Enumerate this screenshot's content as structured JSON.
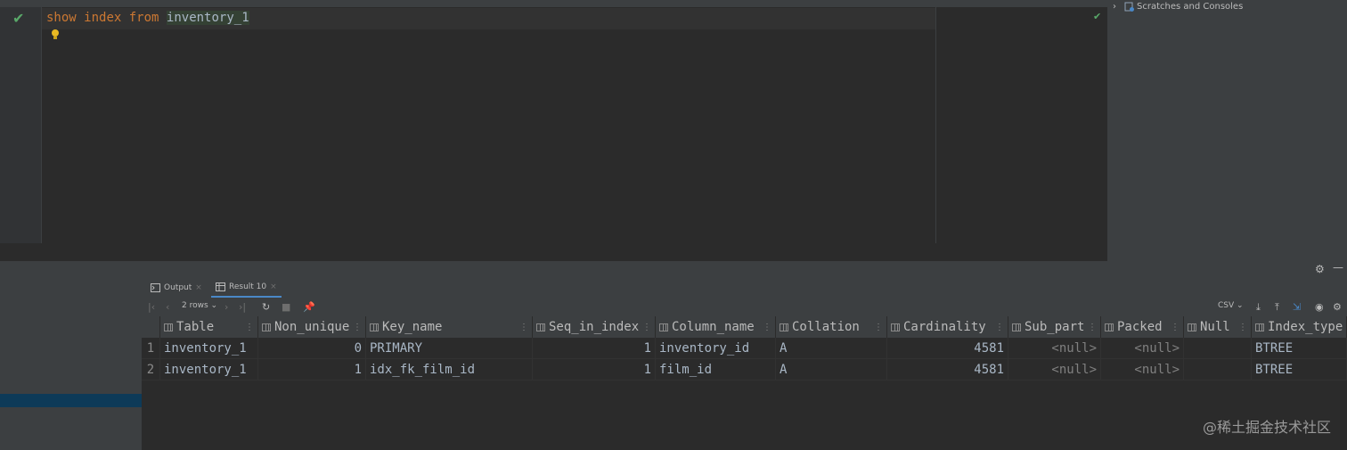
{
  "editor": {
    "code_keyword_show": "show",
    "code_keyword_index": "index",
    "code_keyword_from": "from",
    "code_table": "inventory_1"
  },
  "project_panel": {
    "scratches_label": "Scratches and Consoles"
  },
  "services": {
    "tabs": [
      {
        "label": "Output"
      },
      {
        "label": "Result 10"
      }
    ],
    "toolbar": {
      "rows_label": "2 rows",
      "export_format": "CSV"
    }
  },
  "table": {
    "columns": [
      "Table",
      "Non_unique",
      "Key_name",
      "Seq_in_index",
      "Column_name",
      "Collation",
      "Cardinality",
      "Sub_part",
      "Packed",
      "Null",
      "Index_type"
    ],
    "rows": [
      {
        "num": "1",
        "Table": "inventory_1",
        "Non_unique": "0",
        "Key_name": "PRIMARY",
        "Seq_in_index": "1",
        "Column_name": "inventory_id",
        "Collation": "A",
        "Cardinality": "4581",
        "Sub_part": "<null>",
        "Packed": "<null>",
        "Null": "",
        "Index_type": "BTREE"
      },
      {
        "num": "2",
        "Table": "inventory_1",
        "Non_unique": "1",
        "Key_name": "idx_fk_film_id",
        "Seq_in_index": "1",
        "Column_name": "film_id",
        "Collation": "A",
        "Cardinality": "4581",
        "Sub_part": "<null>",
        "Packed": "<null>",
        "Null": "",
        "Index_type": "BTREE"
      }
    ]
  },
  "watermark": "@稀土掘金技术社区",
  "colors": {
    "background": "#2b2b2b",
    "panel": "#3c3f41",
    "keyword": "#cc7832",
    "success_check": "#59a869",
    "selection": "#0d3a58"
  }
}
